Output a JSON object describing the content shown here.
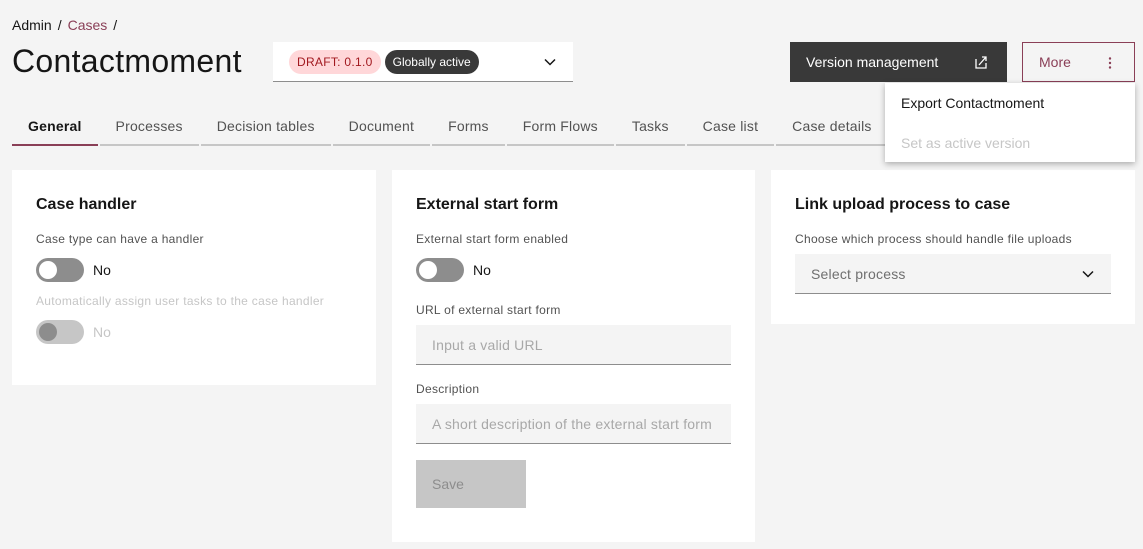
{
  "breadcrumb": {
    "items": [
      "Admin",
      "Cases"
    ],
    "separator": "/"
  },
  "page_title": "Contactmoment",
  "version_select": {
    "draft_tag": "DRAFT: 0.1.0",
    "active_tag": "Globally active"
  },
  "header_actions": {
    "version_management": "Version management",
    "more": "More"
  },
  "more_menu": {
    "items": [
      {
        "label": "Export Contactmoment",
        "disabled": false
      },
      {
        "label": "Set as active version",
        "disabled": true
      }
    ]
  },
  "tabs": [
    "General",
    "Processes",
    "Decision tables",
    "Document",
    "Forms",
    "Form Flows",
    "Tasks",
    "Case list",
    "Case details"
  ],
  "case_handler": {
    "title": "Case handler",
    "handler_label": "Case type can have a handler",
    "handler_toggle": "No",
    "auto_assign_label": "Automatically assign user tasks to the case handler",
    "auto_assign_toggle": "No"
  },
  "external_start_form": {
    "title": "External start form",
    "enabled_label": "External start form enabled",
    "enabled_toggle": "No",
    "url_label": "URL of external start form",
    "url_placeholder": "Input a valid URL",
    "description_label": "Description",
    "description_placeholder": "A short description of the external start form",
    "save_label": "Save"
  },
  "link_upload": {
    "title": "Link upload process to case",
    "label": "Choose which process should handle file uploads",
    "select_placeholder": "Select process"
  },
  "colors": {
    "accent": "#8a3f57",
    "dark_button": "#393939",
    "draft_tag_bg": "#ffd7d9",
    "background": "#f4f4f4"
  }
}
